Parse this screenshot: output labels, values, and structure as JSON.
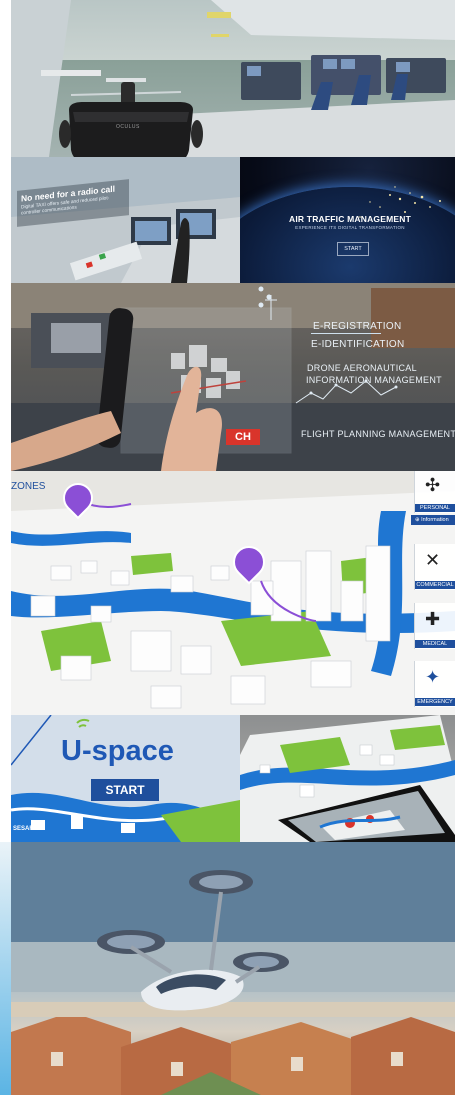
{
  "panel_vr": {
    "headset_brand": "OCULUS"
  },
  "panel_radio": {
    "headline": "No need for a radio call",
    "body": "Digital TAXI offers safe and reduced pilot-controller communications"
  },
  "panel_atm": {
    "title": "AIR TRAFFIC MANAGEMENT",
    "subtitle": "EXPERIENCE ITS DIGITAL TRANSFORMATION",
    "start_label": "START"
  },
  "panel_hud": {
    "items": [
      "E-REGISTRATION",
      "E-IDENTIFICATION",
      "DRONE AERONAUTICAL",
      "INFORMATION MANAGEMENT",
      "FLIGHT PLANNING MANAGEMENT"
    ],
    "partial_button": "CH"
  },
  "panel_map": {
    "zones_label": "ZONES",
    "side_items": [
      {
        "label": "PERSONAL",
        "icon": "drone-icon"
      },
      {
        "label": "COMMERCIAL",
        "icon": "quadcopter-icon"
      },
      {
        "label": "MEDICAL",
        "icon": "medical-drone-icon"
      },
      {
        "label": "EMERGENCY",
        "icon": "emergency-drone-icon"
      }
    ],
    "info_label": "Information",
    "colors": {
      "water": "#1f76d2",
      "park": "#7ec23c",
      "accent": "#6b2fb0",
      "sidebar": "#1f4f9d"
    }
  },
  "panel_uspace": {
    "title": "U-space",
    "start_label": "START",
    "footer": "SESAR"
  },
  "colors": {
    "brand_blue": "#1f4f9d",
    "hud_red": "#d9342b"
  }
}
